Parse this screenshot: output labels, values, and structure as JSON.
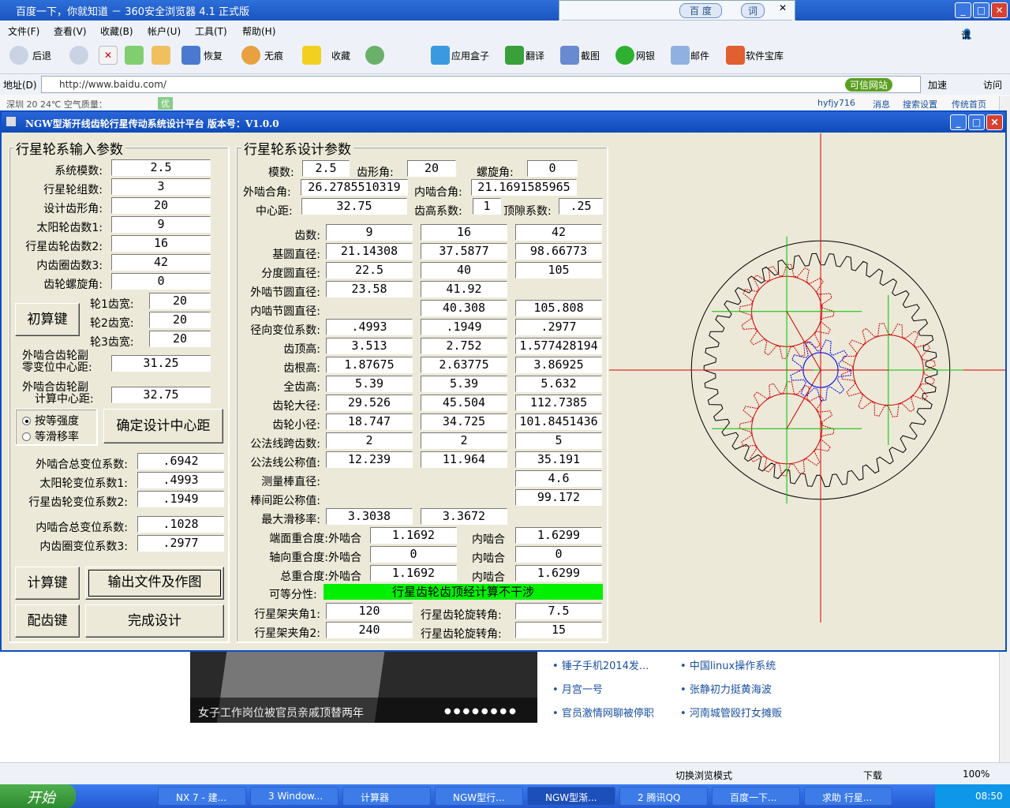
{
  "browser": {
    "title": "百度一下，你就知道 － 360安全浏览器 4.1 正式版",
    "search_engine": "百 度",
    "search_mode": "词",
    "menu": [
      "文件(F)",
      "查看(V)",
      "收藏(B)",
      "帐户(U)",
      "工具(T)",
      "帮助(H)"
    ],
    "login": "请登录",
    "toolbar": {
      "back": "后退",
      "restore": "恢复",
      "notrace": "无痕",
      "favorites": "收藏",
      "appbox": "应用盒子",
      "translate": "翻译",
      "screenshot": "截图",
      "bank": "网银",
      "mail": "邮件",
      "software": "软件宝库"
    },
    "address_label": "地址(D)",
    "url": "http://www.baidu.com/",
    "trusted": "可信网站",
    "accelerate": "加速",
    "visit": "访问",
    "strip_left": "深圳  20  24℃  空气质量：",
    "strip_aqi": "优",
    "strip_right": [
      "hyfjy716",
      "消息",
      "搜索设置",
      "传统首页"
    ]
  },
  "app": {
    "title": "NGW型渐开线齿轮行星传动系统设计平台   版本号：V1.0.0",
    "input_group": "行星轮系输入参数",
    "design_group": "行星轮系设计参数",
    "inputs": [
      {
        "label": "系统模数:",
        "value": "2.5"
      },
      {
        "label": "行星轮组数:",
        "value": "3"
      },
      {
        "label": "设计齿形角:",
        "value": "20"
      },
      {
        "label": "太阳轮齿数1:",
        "value": "9"
      },
      {
        "label": "行星齿轮齿数2:",
        "value": "16"
      },
      {
        "label": "内齿圈齿数3:",
        "value": "42"
      },
      {
        "label": "齿轮螺旋角:",
        "value": "0"
      }
    ],
    "widths": [
      {
        "label": "轮1齿宽:",
        "value": "20"
      },
      {
        "label": "轮2齿宽:",
        "value": "20"
      },
      {
        "label": "轮3齿宽:",
        "value": "20"
      }
    ],
    "btn_initial": "初算键",
    "zero_center": {
      "label1": "外啮合齿轮副",
      "label2": "零变位中心距:",
      "value": "31.25"
    },
    "calc_center": {
      "label1": "外啮合齿轮副",
      "label2": "计算中心距:",
      "value": "32.75"
    },
    "radio1": "按等强度",
    "radio2": "等滑移率",
    "btn_center": "确定设计中心距",
    "shifts": [
      {
        "label": "外啮合总变位系数:",
        "value": ".6942"
      },
      {
        "label": "太阳轮变位系数1:",
        "value": ".4993"
      },
      {
        "label": "行星齿轮变位系数2:",
        "value": ".1949"
      },
      {
        "label": "内啮合总变位系数:",
        "value": ".1028"
      },
      {
        "label": "内齿圈变位系数3:",
        "value": ".2977"
      }
    ],
    "btn_calc": "计算键",
    "btn_output": "输出文件及作图",
    "btn_mesh": "配齿键",
    "btn_finish": "完成设计",
    "top": {
      "module_label": "模数:",
      "module": "2.5",
      "pa_label": "齿形角:",
      "pa": "20",
      "helix_label": "螺旋角:",
      "helix": "0",
      "ext_label": "外啮合角:",
      "ext": "26.2785510319",
      "int_label": "内啮合角:",
      "int": "21.1691585965",
      "center_label": "中心距:",
      "center": "32.75",
      "addcoef_label": "齿高系数:",
      "addcoef": "1",
      "clear_label": "顶隙系数:",
      "clear": ".25"
    },
    "table": [
      {
        "label": "齿数:",
        "v": [
          "9",
          "16",
          "42"
        ]
      },
      {
        "label": "基圆直径:",
        "v": [
          "21.14308",
          "37.5877",
          "98.66773"
        ]
      },
      {
        "label": "分度圆直径:",
        "v": [
          "22.5",
          "40",
          "105"
        ]
      },
      {
        "label": "外啮节圆直径:",
        "v": [
          "23.58",
          "41.92",
          ""
        ]
      },
      {
        "label": "内啮节圆直径:",
        "v": [
          "",
          "40.308",
          "105.808"
        ]
      },
      {
        "label": "径向变位系数:",
        "v": [
          ".4993",
          ".1949",
          ".2977"
        ]
      },
      {
        "label": "齿顶高:",
        "v": [
          "3.513",
          "2.752",
          "1.577428194"
        ]
      },
      {
        "label": "齿根高:",
        "v": [
          "1.87675",
          "2.63775",
          "3.86925"
        ]
      },
      {
        "label": "全齿高:",
        "v": [
          "5.39",
          "5.39",
          "5.632"
        ]
      },
      {
        "label": "齿轮大径:",
        "v": [
          "29.526",
          "45.504",
          "112.7385"
        ]
      },
      {
        "label": "齿轮小径:",
        "v": [
          "18.747",
          "34.725",
          "101.8451436"
        ]
      },
      {
        "label": "公法线跨齿数:",
        "v": [
          "2",
          "2",
          "5"
        ]
      },
      {
        "label": "公法线公称值:",
        "v": [
          "12.239",
          "11.964",
          "35.191"
        ]
      },
      {
        "label": "测量棒直径:",
        "v": [
          "",
          "",
          "4.6"
        ]
      },
      {
        "label": "棒间距公称值:",
        "v": [
          "",
          "",
          "99.172"
        ]
      },
      {
        "label": "最大滑移率:",
        "v": [
          "3.3038",
          "3.3672",
          ""
        ]
      }
    ],
    "overlap": [
      {
        "label": "端面重合度:外啮合",
        "v1": "1.1692",
        "label2": "内啮合",
        "v2": "1.6299"
      },
      {
        "label": "轴向重合度:外啮合",
        "v1": "0",
        "label2": "内啮合",
        "v2": "0"
      },
      {
        "label": "总重合度:外啮合",
        "v1": "1.1692",
        "label2": "内啮合",
        "v2": "1.6299"
      }
    ],
    "assembly_label": "可等分性:",
    "assembly_status": "行星齿轮齿顶经计算不干涉",
    "carrier": [
      {
        "label": "行星架夹角1:",
        "v": "120",
        "label2": "行星齿轮旋转角:",
        "v2": "7.5"
      },
      {
        "label": "行星架夹角2:",
        "v": "240",
        "label2": "行星齿轮旋转角:",
        "v2": "15"
      }
    ],
    "colors": {
      "ring": "#000000",
      "planet": "#d00000",
      "sun": "#0000e0",
      "axis_red": "#e00000",
      "axis_green": "#00c000"
    }
  },
  "page": {
    "news_caption": "女子工作岗位被官员亲戚顶替两年",
    "links_left": [
      "锤子手机2014发...",
      "月宫一号",
      "官员激情网聊被停职"
    ],
    "links_right": [
      "中国linux操作系统",
      "张静初力挺黄海波",
      "河南城管殴打女摊贩"
    ]
  },
  "status": {
    "mode": "切换浏览模式",
    "download": "下载",
    "zoom": "100%"
  },
  "taskbar": {
    "start": "开始",
    "tasks": [
      "NX 7 - 建...",
      "3 Window...",
      "计算器",
      "NGW型行...",
      "NGW型渐...",
      "2 腾讯QQ",
      "百度一下...",
      "求助 行星..."
    ],
    "clock": "08:50"
  }
}
